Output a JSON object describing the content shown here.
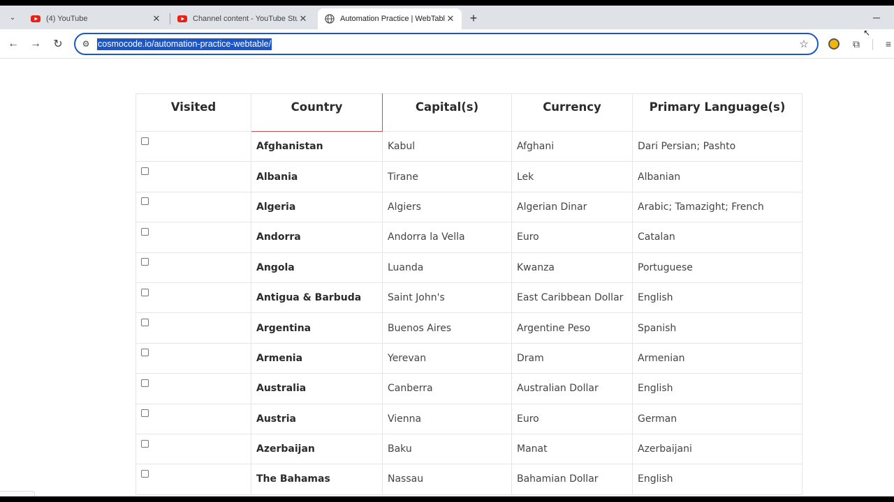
{
  "browser": {
    "tabs": [
      {
        "title": "(4) YouTube",
        "favicon": "youtube-icon",
        "active": false
      },
      {
        "title": "Channel content - YouTube Studio",
        "favicon": "youtube-icon",
        "active": false
      },
      {
        "title": "Automation Practice | WebTables",
        "favicon": "globe-icon",
        "active": true
      }
    ],
    "url": "cosmocode.io/automation-practice-webtable/",
    "glyphs": {
      "tab_search": "⌄",
      "close": "✕",
      "new_tab": "+",
      "minimize": "─",
      "back": "←",
      "forward": "→",
      "reload": "↻",
      "site_info": "⚙",
      "star": "☆",
      "puzzle": "⧉",
      "menu": "≡"
    }
  },
  "table": {
    "headers": [
      "Visited",
      "Country",
      "Capital(s)",
      "Currency",
      "Primary Language(s)"
    ],
    "rows": [
      {
        "country": "Afghanistan",
        "capital": "Kabul",
        "currency": "Afghani",
        "language": "Dari Persian; Pashto"
      },
      {
        "country": "Albania",
        "capital": "Tirane",
        "currency": "Lek",
        "language": "Albanian"
      },
      {
        "country": "Algeria",
        "capital": "Algiers",
        "currency": "Algerian Dinar",
        "language": "Arabic; Tamazight; French"
      },
      {
        "country": "Andorra",
        "capital": "Andorra la Vella",
        "currency": "Euro",
        "language": "Catalan"
      },
      {
        "country": "Angola",
        "capital": "Luanda",
        "currency": "Kwanza",
        "language": "Portuguese"
      },
      {
        "country": "Antigua & Barbuda",
        "capital": "Saint John's",
        "currency": "East Caribbean Dollar",
        "language": "English"
      },
      {
        "country": "Argentina",
        "capital": "Buenos Aires",
        "currency": "Argentine Peso",
        "language": "Spanish"
      },
      {
        "country": "Armenia",
        "capital": "Yerevan",
        "currency": "Dram",
        "language": "Armenian"
      },
      {
        "country": "Australia",
        "capital": "Canberra",
        "currency": "Australian Dollar",
        "language": "English"
      },
      {
        "country": "Austria",
        "capital": "Vienna",
        "currency": "Euro",
        "language": "German"
      },
      {
        "country": "Azerbaijan",
        "capital": "Baku",
        "currency": "Manat",
        "language": "Azerbaijani"
      },
      {
        "country": "The Bahamas",
        "capital": "Nassau",
        "currency": "Bahamian Dollar",
        "language": "English"
      }
    ]
  }
}
